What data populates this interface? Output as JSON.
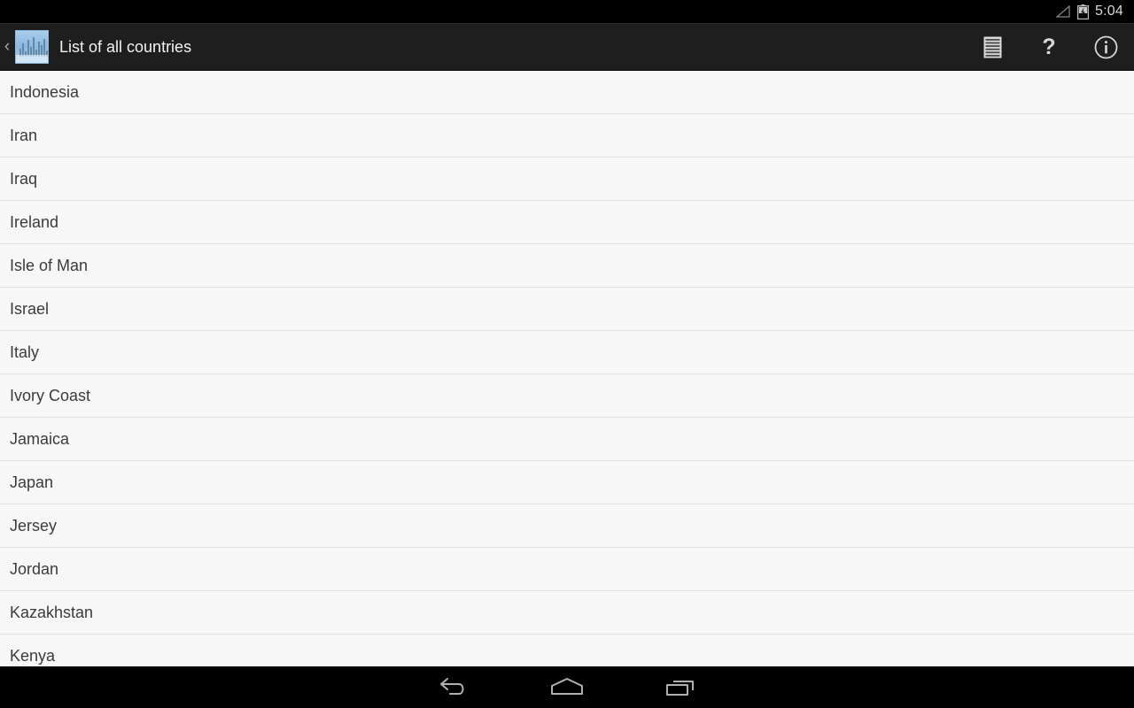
{
  "status_bar": {
    "time": "5:04",
    "signal_icon": "signal-triangle-icon",
    "battery_icon": "battery-charging-icon"
  },
  "action_bar": {
    "up_chevron": "‹",
    "app_icon": "app-logo-skyline-icon",
    "title": "List of all countries",
    "actions": [
      {
        "name": "document-list-icon",
        "label": ""
      },
      {
        "name": "help-icon",
        "label": "?"
      },
      {
        "name": "info-icon",
        "label": ""
      }
    ]
  },
  "list": {
    "items": [
      {
        "label": "Indonesia"
      },
      {
        "label": "Iran"
      },
      {
        "label": "Iraq"
      },
      {
        "label": "Ireland"
      },
      {
        "label": "Isle of Man"
      },
      {
        "label": "Israel"
      },
      {
        "label": "Italy"
      },
      {
        "label": "Ivory Coast"
      },
      {
        "label": "Jamaica"
      },
      {
        "label": "Japan"
      },
      {
        "label": "Jersey"
      },
      {
        "label": "Jordan"
      },
      {
        "label": "Kazakhstan"
      },
      {
        "label": "Kenya"
      }
    ]
  },
  "nav_bar": {
    "buttons": [
      {
        "name": "back-button"
      },
      {
        "name": "home-button"
      },
      {
        "name": "recents-button"
      }
    ]
  },
  "colors": {
    "action_bar_bg": "#1e1e1e",
    "list_bg": "#f7f7f7",
    "divider": "#e2e2e2",
    "text_primary": "#3b3b3b",
    "accent_icon": "#8bb9e0"
  }
}
